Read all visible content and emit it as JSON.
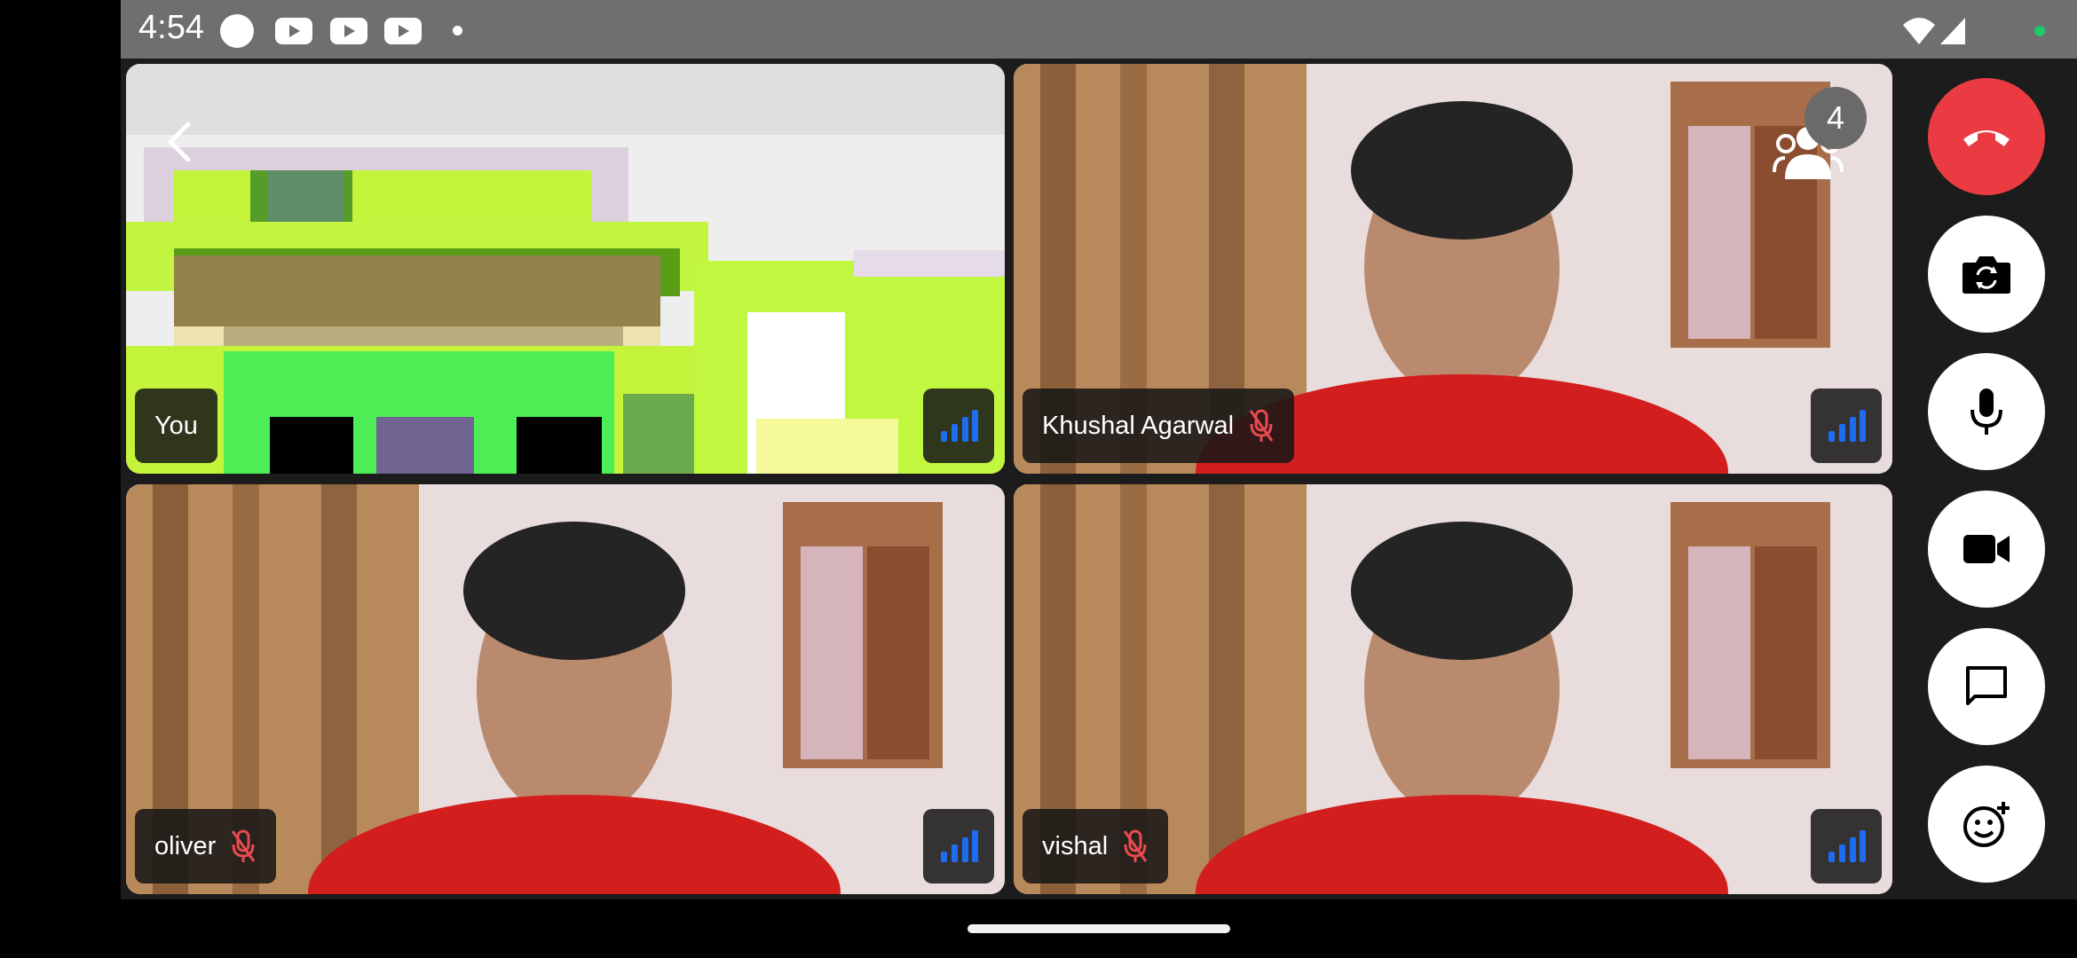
{
  "status_bar": {
    "time": "4:54",
    "notification_icons": [
      "circle-icon",
      "youtube-icon",
      "youtube-icon",
      "youtube-icon",
      "dot-icon"
    ],
    "system_icons": [
      "wifi-icon",
      "cellular-signal-icon",
      "green-dot-icon"
    ]
  },
  "call": {
    "participant_count": "4",
    "tiles": [
      {
        "name": "You",
        "mic_muted": false
      },
      {
        "name": "Khushal Agarwal",
        "mic_muted": true
      },
      {
        "name": "oliver",
        "mic_muted": true
      },
      {
        "name": "vishal",
        "mic_muted": true
      }
    ]
  },
  "controls": [
    "end-call-icon",
    "switch-camera-icon",
    "microphone-icon",
    "video-camera-icon",
    "chat-icon",
    "add-reaction-icon"
  ],
  "colors": {
    "end_call": "#ea3b42",
    "signal_bars": "#1e6df0",
    "mute_icon": "#e84a4f",
    "status_bar": "#6f6f6f",
    "stage_bg": "#1c1c1c"
  }
}
